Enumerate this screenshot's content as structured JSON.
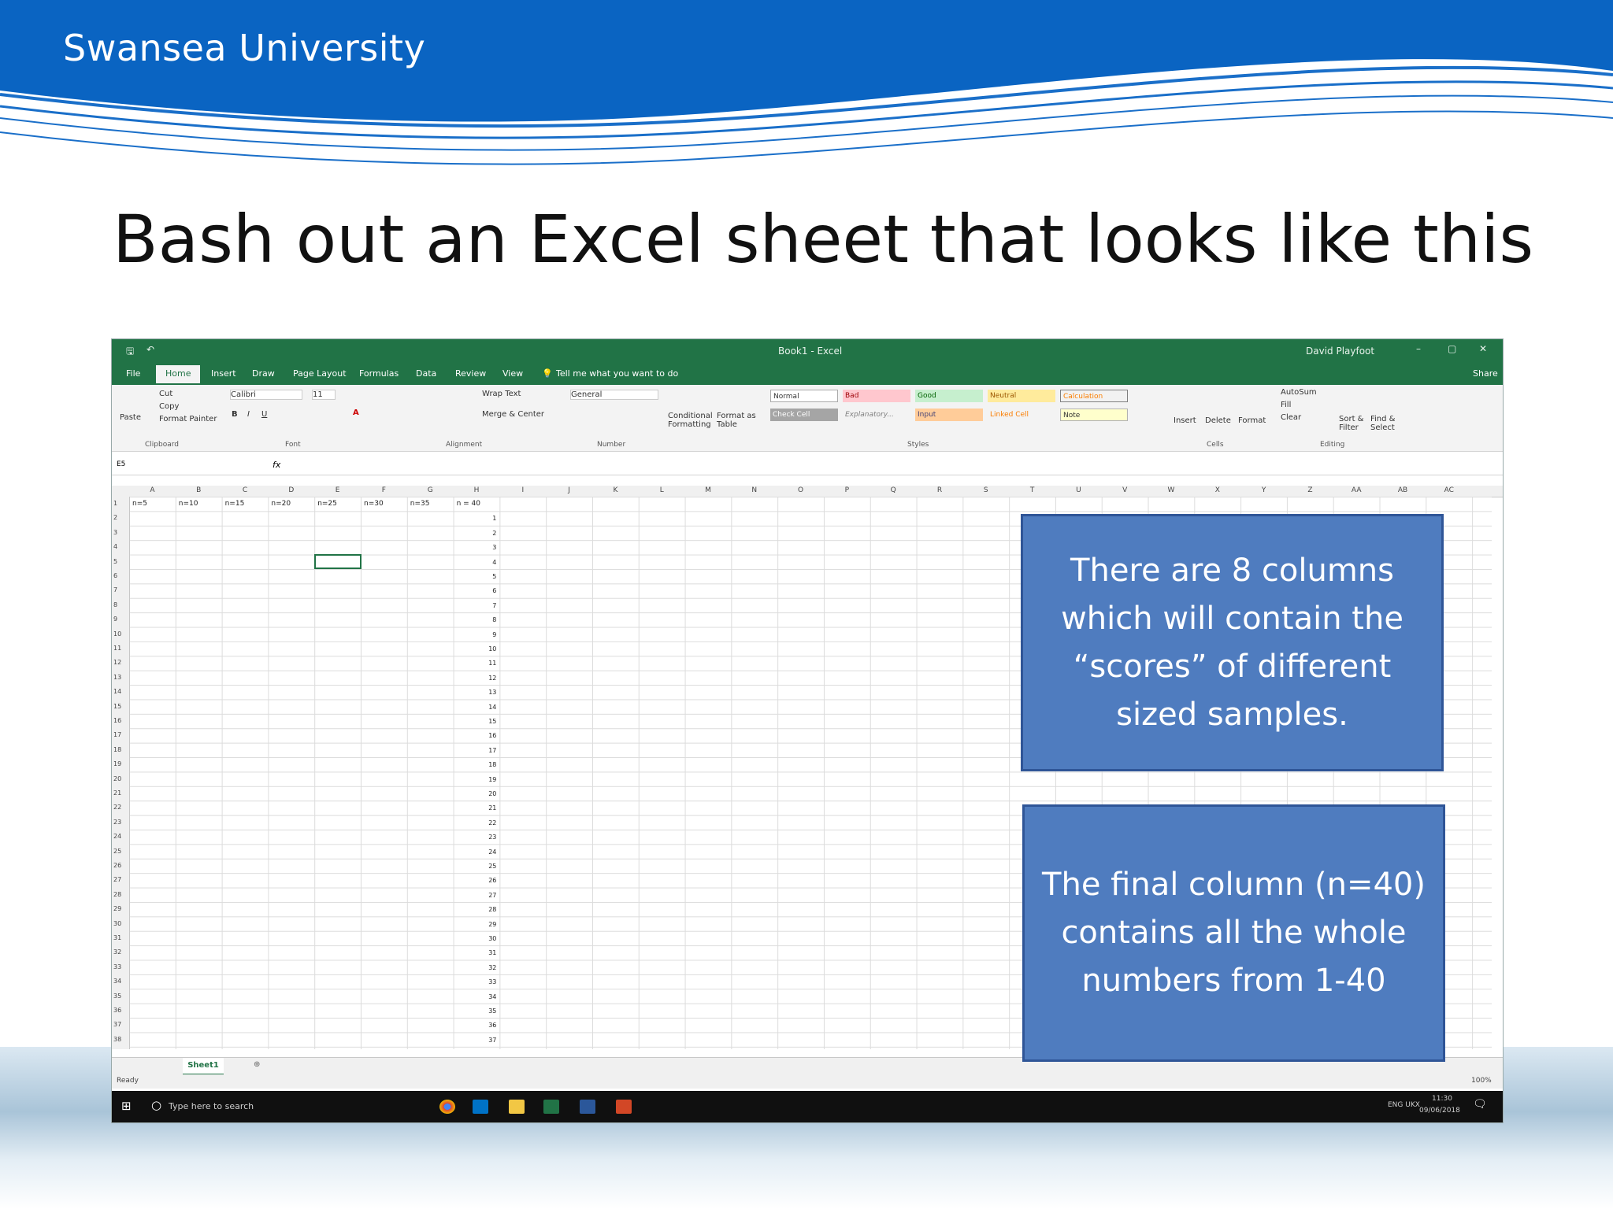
{
  "slide": {
    "brand": "Swansea University",
    "title": "Bash out an Excel sheet that looks like this",
    "colors": {
      "banner": "#0a64c2",
      "callout_fill": "#4f7cbf",
      "callout_border": "#2f5597",
      "excel_green": "#217346"
    }
  },
  "excel": {
    "window_title": "Book1 - Excel",
    "user": "David Playfoot",
    "tabs": [
      "File",
      "Home",
      "Insert",
      "Draw",
      "Page Layout",
      "Formulas",
      "Data",
      "Review",
      "View"
    ],
    "tell_me": "Tell me what you want to do",
    "share": "Share",
    "ribbon": {
      "cut": "Cut",
      "copy": "Copy",
      "format_painter": "Format Painter",
      "paste": "Paste",
      "font_name": "Calibri",
      "font_size": "11",
      "wrap_text": "Wrap Text",
      "merge_center": "Merge & Center",
      "number_format": "General",
      "conditional_formatting": "Conditional Formatting",
      "format_as_table": "Format as Table",
      "styles": {
        "normal": "Normal",
        "bad": "Bad",
        "good": "Good",
        "neutral": "Neutral",
        "calculation": "Calculation",
        "check_cell": "Check Cell",
        "explanatory": "Explanatory...",
        "input": "Input",
        "linked_cell": "Linked Cell",
        "note": "Note"
      },
      "insert": "Insert",
      "delete": "Delete",
      "format": "Format",
      "autosum": "AutoSum",
      "fill": "Fill",
      "clear": "Clear",
      "sort_filter": "Sort & Filter",
      "find_select": "Find & Select",
      "groups": {
        "clipboard": "Clipboard",
        "font": "Font",
        "alignment": "Alignment",
        "number": "Number",
        "styles": "Styles",
        "cells": "Cells",
        "editing": "Editing"
      }
    },
    "name_box": "E5",
    "columns": [
      "A",
      "B",
      "C",
      "D",
      "E",
      "F",
      "G",
      "H",
      "I",
      "J",
      "K",
      "L",
      "M",
      "N",
      "O",
      "P",
      "Q",
      "R",
      "S",
      "T",
      "U",
      "V",
      "W",
      "X",
      "Y",
      "Z",
      "AA",
      "AB",
      "AC"
    ],
    "row1_headers": [
      "n=5",
      "n=10",
      "n=15",
      "n=20",
      "n=25",
      "n=30",
      "n=35",
      "n = 40"
    ],
    "h_column_values": [
      1,
      2,
      3,
      4,
      5,
      6,
      7,
      8,
      9,
      10,
      11,
      12,
      13,
      14,
      15,
      16,
      17,
      18,
      19,
      20,
      21,
      22,
      23,
      24,
      25,
      26,
      27,
      28,
      29,
      30,
      31,
      32,
      33,
      34,
      35,
      36,
      37
    ],
    "sheet_tab": "Sheet1",
    "status": "Ready",
    "zoom": "100%",
    "search_placeholder": "Type here to search",
    "time": "11:30",
    "date": "09/06/2018",
    "lang": "ENG UKX"
  },
  "callouts": [
    {
      "text": "There are 8 columns which will contain the “scores” of different sized samples."
    },
    {
      "text": "The final column (n=40) contains all the whole numbers from 1-40"
    }
  ]
}
